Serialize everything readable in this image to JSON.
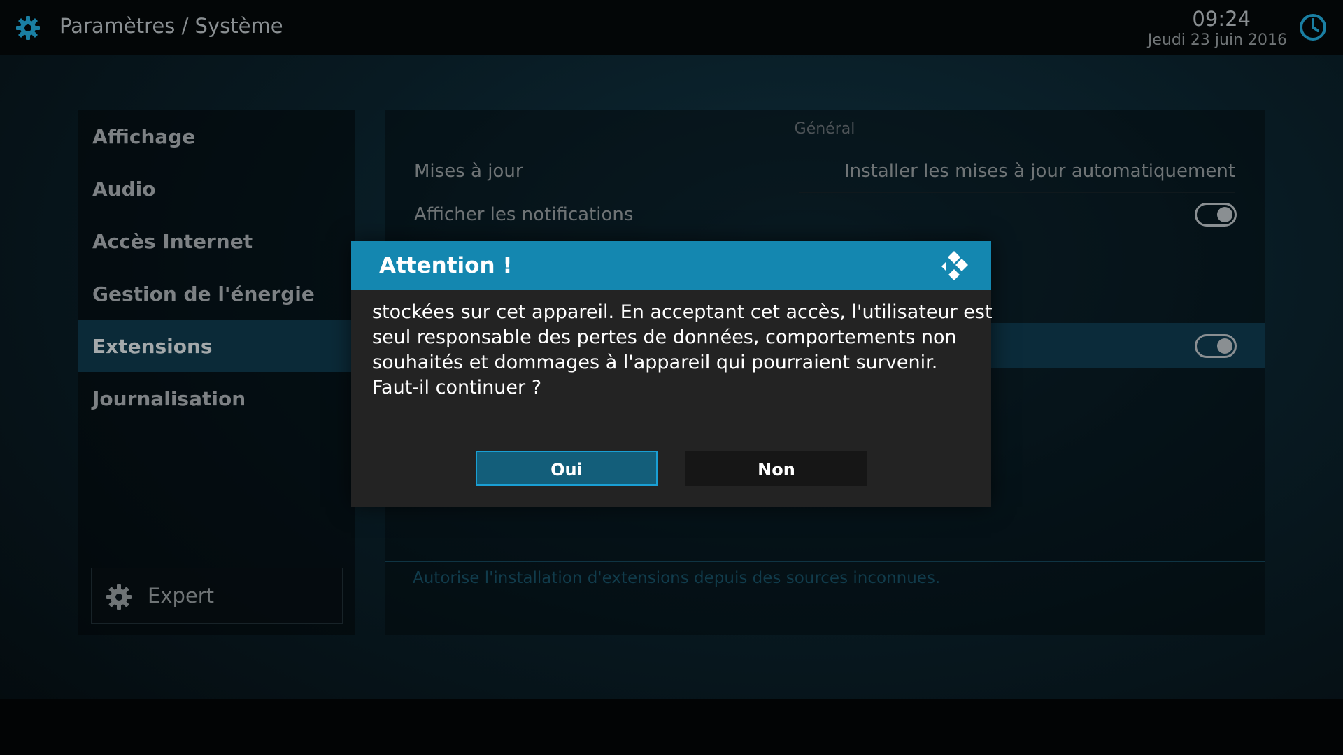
{
  "header": {
    "title": "Paramètres / Système",
    "time": "09:24",
    "date": "Jeudi 23 juin 2016"
  },
  "sidebar": {
    "items": [
      {
        "label": "Affichage"
      },
      {
        "label": "Audio"
      },
      {
        "label": "Accès Internet"
      },
      {
        "label": "Gestion de l'énergie"
      },
      {
        "label": "Extensions"
      },
      {
        "label": "Journalisation"
      }
    ],
    "active_index": 4,
    "expert_label": "Expert"
  },
  "main": {
    "group_title": "Général",
    "rows": [
      {
        "label": "Mises à jour",
        "value": "Installer les mises à jour automatiquement"
      },
      {
        "label": "Afficher les notifications",
        "toggle": true
      }
    ],
    "description": "Autorise l'installation d'extensions depuis des sources inconnues."
  },
  "dialog": {
    "title": "Attention !",
    "lines": [
      "stockées sur cet appareil. En acceptant cet accès, l'utilisateur est",
      "seul responsable des pertes de données, comportements non",
      "souhaités et dommages à l'appareil qui pourraient survenir.",
      "Faut-il continuer ?"
    ],
    "yes_label": "Oui",
    "no_label": "Non"
  },
  "colors": {
    "accent": "#1487b0",
    "highlight": "#0b2b3a",
    "dialog_bg": "#232323"
  }
}
